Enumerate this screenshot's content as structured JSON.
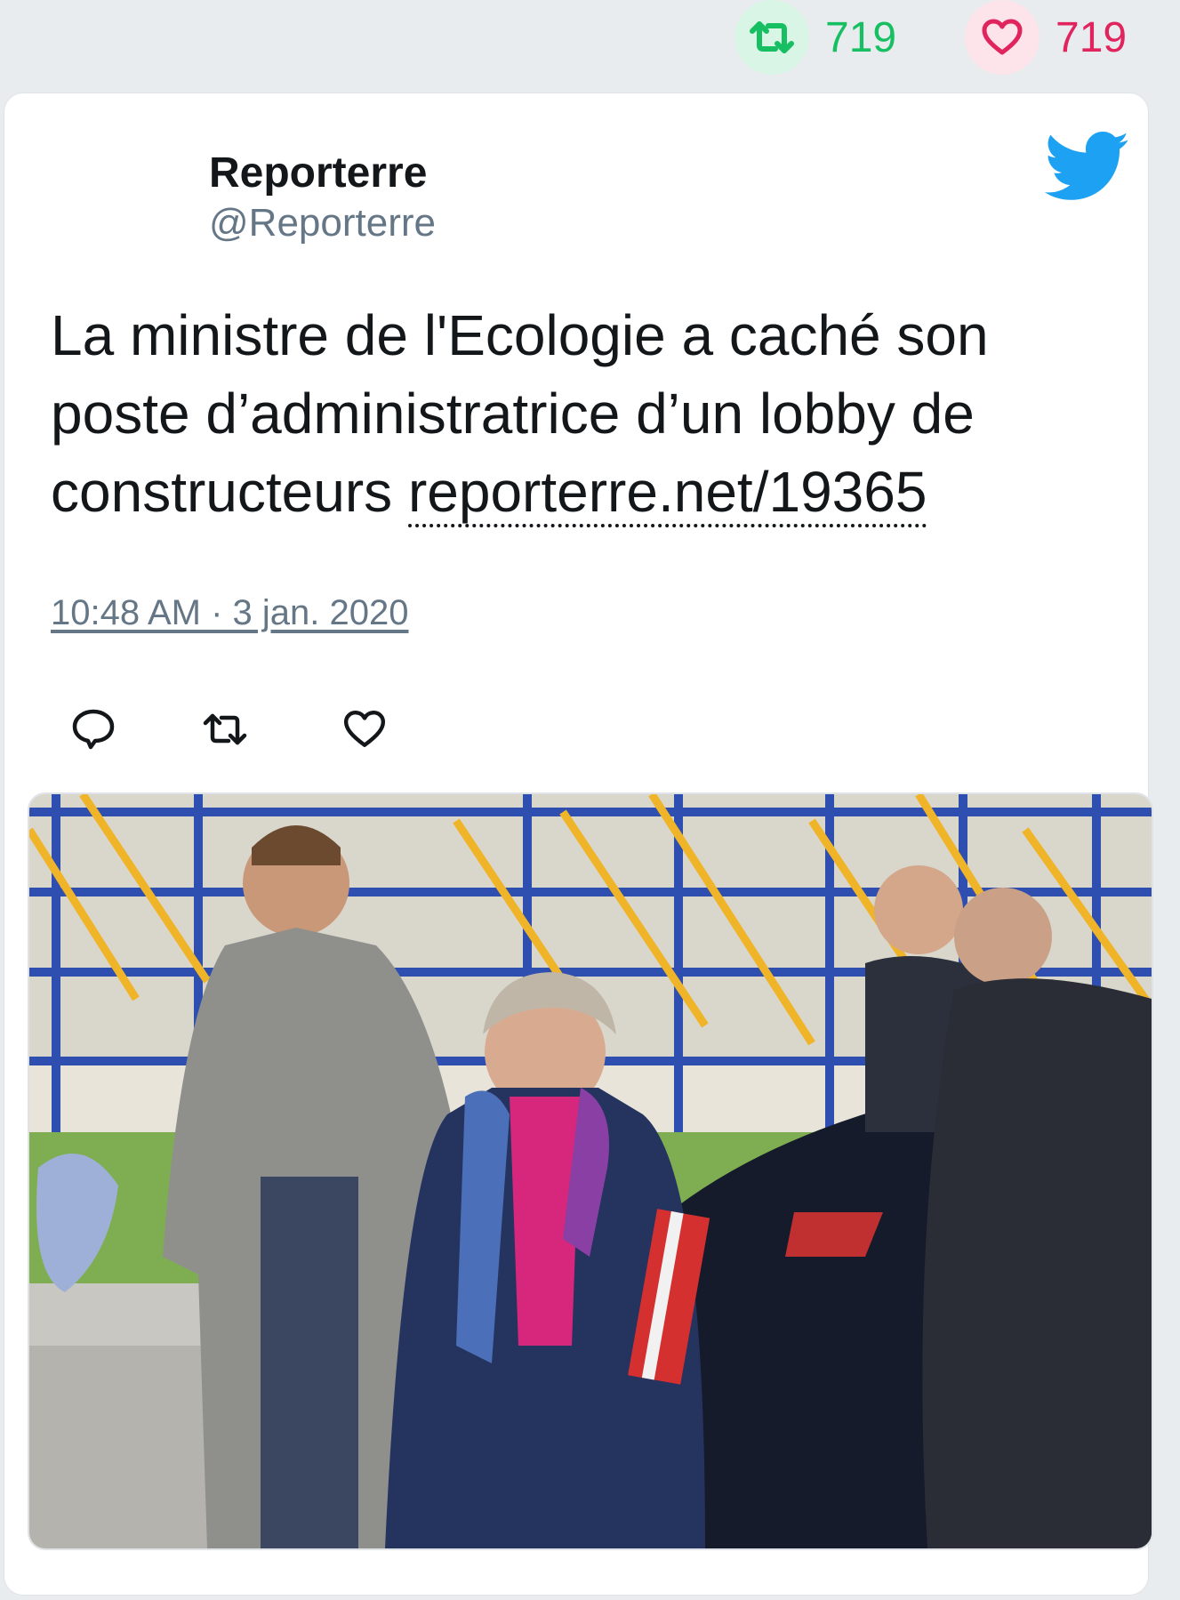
{
  "stats": {
    "retweet_count": "719",
    "like_count": "719",
    "retweet_color": "#17bf63",
    "like_color": "#e0245e"
  },
  "tweet": {
    "author_name": "Reporterre",
    "author_handle": "@Reporterre",
    "text": "La ministre de l'Ecologie a caché son poste d’administratrice d’un lobby de constructeurs ",
    "link_text": "reporterre.net/19365",
    "timestamp": "10:48 AM · 3 jan. 2020"
  },
  "icons": {
    "brand": "twitter-bird-icon",
    "actions": [
      "reply-icon",
      "retweet-icon",
      "like-icon"
    ]
  },
  "colors": {
    "twitter_blue": "#1da1f2",
    "text": "#14171a",
    "muted": "#657786"
  }
}
